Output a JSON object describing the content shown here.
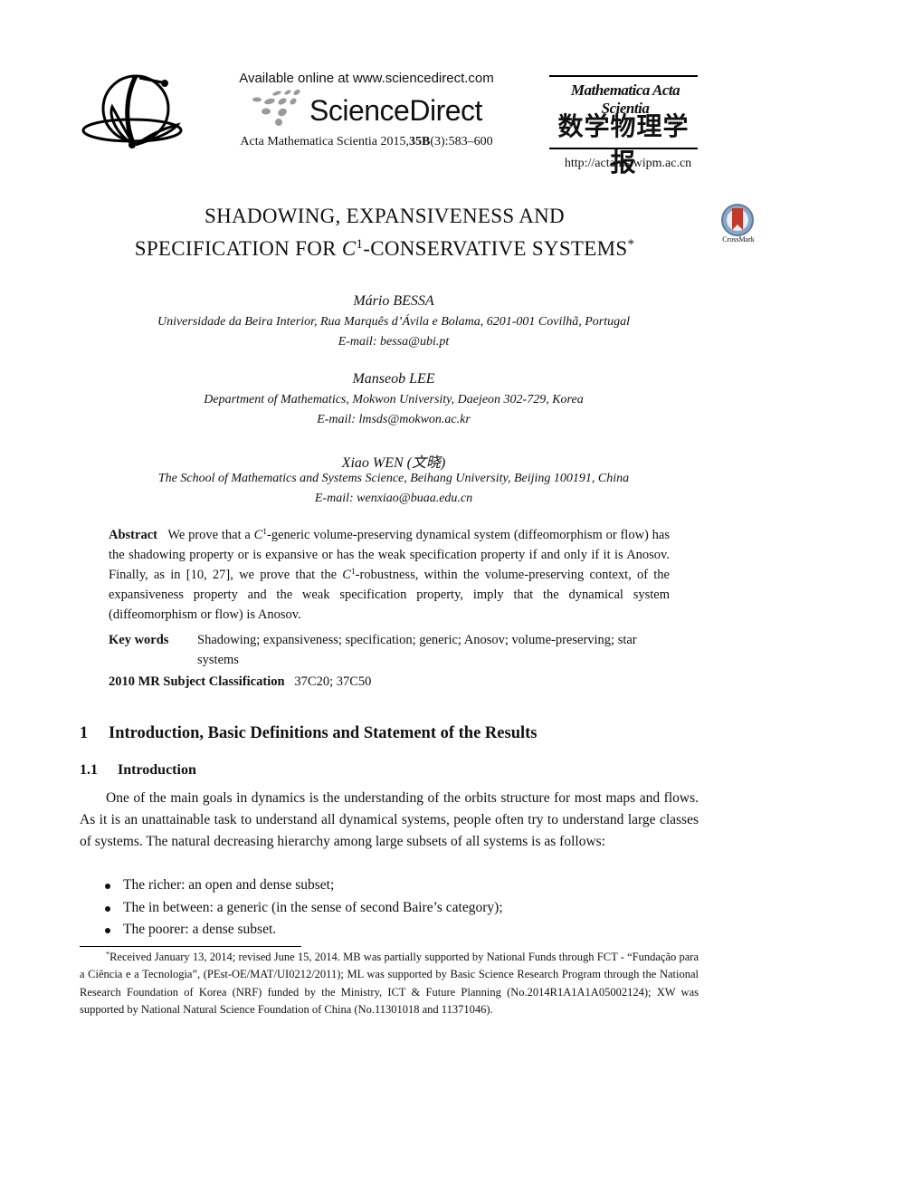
{
  "header": {
    "available_online": "Available online at www.sciencedirect.com",
    "sciencedirect_brand": "ScienceDirect",
    "citation_prefix": "Acta Mathematica Scientia 2015,",
    "citation_volume": "35B",
    "citation_suffix": "(3):583–600",
    "journal_logo_latin": "Mathematica Acta Scientia",
    "journal_logo_chinese": "数学物理学报",
    "journal_url": "http://actams.wipm.ac.cn",
    "left_logo_icon": "journal-sphere-logo-icon",
    "crossmark_label": "CrossMark",
    "crossmark_icon": "crossmark-icon"
  },
  "title": {
    "line1": "SHADOWING, EXPANSIVENESS AND",
    "line2_prefix": "SPECIFICATION FOR ",
    "line2_math": "C",
    "line2_sup": "1",
    "line2_suffix": "-CONSERVATIVE SYSTEMS",
    "footnote_mark": "*"
  },
  "authors": [
    {
      "name": "Mário  BESSA",
      "affiliation": "Universidade da Beira Interior, Rua Marquês d’Ávila e Bolama, 6201-001 Covilhã, Portugal",
      "email_label": "E-mail",
      "email": "bessa@ubi.pt"
    },
    {
      "name": "Manseob LEE",
      "affiliation": "Department of Mathematics, Mokwon University, Daejeon 302-729, Korea",
      "email_label": "E-mail",
      "email": "lmsds@mokwon.ac.kr"
    },
    {
      "name": "Xiao WEN (文晓)",
      "affiliation": "The School of Mathematics and Systems Science, Beihang University, Beijing 100191, China",
      "email_label": "E-mail",
      "email": "wenxiao@buaa.edu.cn"
    }
  ],
  "abstract": {
    "label": "Abstract",
    "part1": "We prove that a ",
    "math1": "C",
    "sup1": "1",
    "part2": "-generic volume-preserving dynamical system (diffeomorphism or flow) has the shadowing property or is expansive or has the weak specification property if and only if it is Anosov. Finally, as in [10, 27], we prove that the ",
    "math2": "C",
    "sup2": "1",
    "part3": "-robustness, within the volume-preserving context, of the expansiveness property and the weak specification property, imply that the dynamical system (diffeomorphism or flow) is Anosov."
  },
  "keywords": {
    "label": "Key words",
    "text": "Shadowing; expansiveness; specification; generic; Anosov; volume-preserving; star systems"
  },
  "msc": {
    "label": "2010 MR Subject Classification",
    "text": "37C20; 37C50"
  },
  "section1": {
    "number": "1",
    "title": "Introduction, Basic Definitions and Statement of the Results"
  },
  "subsection11": {
    "number": "1.1",
    "title": "Introduction"
  },
  "intro_paragraph": "One of the main goals in dynamics is the understanding of the orbits structure for most maps and flows.  As it is an unattainable task to understand all dynamical systems, people often try to understand large classes of systems. The natural decreasing hierarchy among large subsets of all systems is as follows:",
  "bullets": [
    "The richer: an open and dense subset;",
    "The in between: a generic (in the sense of second Baire’s category);",
    "The poorer: a dense subset."
  ],
  "footnote": {
    "mark": "*",
    "text": "Received January 13, 2014; revised June 15, 2014.  MB was partially supported by National Funds through FCT - “Fundação para a Ciência e a Tecnologia”, (PEst-OE/MAT/UI0212/2011); ML was supported by Basic Science Research Program through the National Research Foundation of Korea (NRF) funded by the Ministry, ICT & Future Planning (No.2014R1A1A1A05002124); XW was supported by National Natural Science Foundation of China (No.11301018 and 11371046)."
  }
}
